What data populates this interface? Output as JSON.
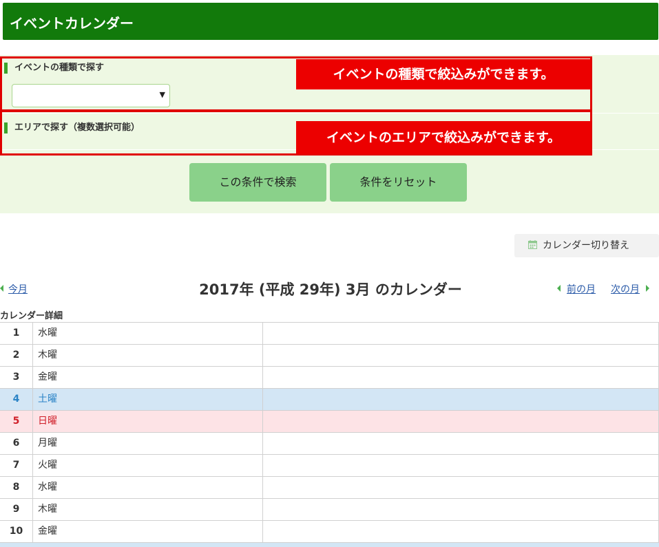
{
  "header": {
    "title": "イベントカレンダー"
  },
  "search": {
    "type_label": "イベントの種類で探す",
    "type_value": "",
    "area_label": "エリアで探す（複数選択可能）",
    "search_button": "この条件で検索",
    "reset_button": "条件をリセット"
  },
  "callouts": {
    "type": "イベントの種類で絞込みができます。",
    "area": "イベントのエリアで絞込みができます。"
  },
  "switch_button": "カレンダー切り替え",
  "calendar": {
    "title": "2017年 (平成 29年) 3月 のカレンダー",
    "this_month": "今月",
    "prev_month": "前の月",
    "next_month": "次の月",
    "caption": "カレンダー詳細",
    "days": [
      {
        "num": "1",
        "weekday": "水曜",
        "kind": "normal"
      },
      {
        "num": "2",
        "weekday": "木曜",
        "kind": "normal"
      },
      {
        "num": "3",
        "weekday": "金曜",
        "kind": "normal"
      },
      {
        "num": "4",
        "weekday": "土曜",
        "kind": "sat"
      },
      {
        "num": "5",
        "weekday": "日曜",
        "kind": "sun"
      },
      {
        "num": "6",
        "weekday": "月曜",
        "kind": "normal"
      },
      {
        "num": "7",
        "weekday": "火曜",
        "kind": "normal"
      },
      {
        "num": "8",
        "weekday": "水曜",
        "kind": "normal"
      },
      {
        "num": "9",
        "weekday": "木曜",
        "kind": "normal"
      },
      {
        "num": "10",
        "weekday": "金曜",
        "kind": "normal"
      }
    ]
  },
  "colors": {
    "header_green": "#127a0b",
    "panel_bg": "#eef8e3",
    "callout_red": "#ec0000",
    "button_green": "#8ad18a",
    "saturday_bg": "#d3e6f5",
    "sunday_bg": "#fde3e6"
  },
  "icons": {
    "switch": "calendar-icon",
    "prev": "triangle-left-icon",
    "next": "triangle-right-icon"
  }
}
